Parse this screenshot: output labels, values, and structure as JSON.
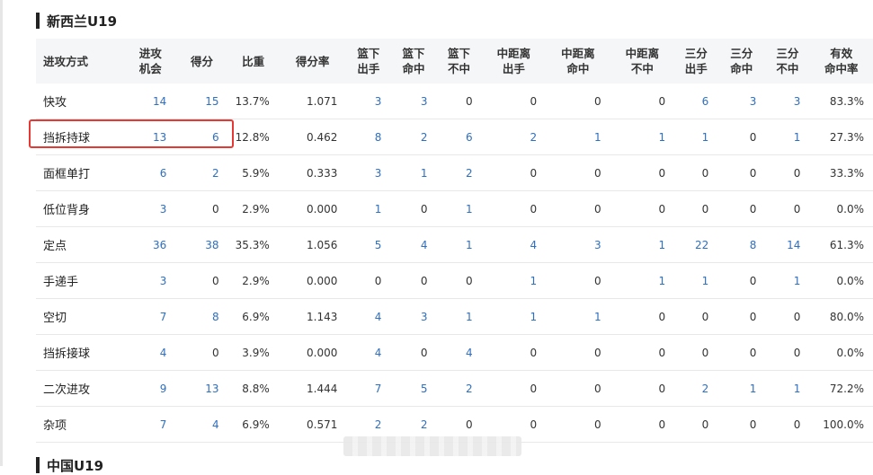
{
  "section_title": "新西兰U19",
  "next_section_title": "中国U19",
  "columns": [
    {
      "key": "type",
      "label": [
        "进攻方式"
      ]
    },
    {
      "key": "opp",
      "label": [
        "进攻",
        "机会"
      ]
    },
    {
      "key": "pts",
      "label": [
        "得分"
      ]
    },
    {
      "key": "pct",
      "label": [
        "比重"
      ]
    },
    {
      "key": "ppp",
      "label": [
        "得分率"
      ]
    },
    {
      "key": "ra",
      "label": [
        "篮下",
        "出手"
      ]
    },
    {
      "key": "rm",
      "label": [
        "篮下",
        "命中"
      ]
    },
    {
      "key": "rx",
      "label": [
        "篮下",
        "不中"
      ]
    },
    {
      "key": "ma",
      "label": [
        "中距离",
        "出手"
      ]
    },
    {
      "key": "mm",
      "label": [
        "中距离",
        "命中"
      ]
    },
    {
      "key": "mx",
      "label": [
        "中距离",
        "不中"
      ]
    },
    {
      "key": "ta",
      "label": [
        "三分",
        "出手"
      ]
    },
    {
      "key": "tm",
      "label": [
        "三分",
        "命中"
      ]
    },
    {
      "key": "tx",
      "label": [
        "三分",
        "不中"
      ]
    },
    {
      "key": "efg",
      "label": [
        "有效",
        "命中率"
      ]
    }
  ],
  "rows": [
    [
      "快攻",
      "14",
      "15",
      "13.7%",
      "1.071",
      "3",
      "3",
      "0",
      "0",
      "0",
      "0",
      "6",
      "3",
      "3",
      "83.3%"
    ],
    [
      "挡拆持球",
      "13",
      "6",
      "12.8%",
      "0.462",
      "8",
      "2",
      "6",
      "2",
      "1",
      "1",
      "1",
      "0",
      "1",
      "27.3%"
    ],
    [
      "面框单打",
      "6",
      "2",
      "5.9%",
      "0.333",
      "3",
      "1",
      "2",
      "0",
      "0",
      "0",
      "0",
      "0",
      "0",
      "33.3%"
    ],
    [
      "低位背身",
      "3",
      "0",
      "2.9%",
      "0.000",
      "1",
      "0",
      "1",
      "0",
      "0",
      "0",
      "0",
      "0",
      "0",
      "0.0%"
    ],
    [
      "定点",
      "36",
      "38",
      "35.3%",
      "1.056",
      "5",
      "4",
      "1",
      "4",
      "3",
      "1",
      "22",
      "8",
      "14",
      "61.3%"
    ],
    [
      "手递手",
      "3",
      "0",
      "2.9%",
      "0.000",
      "0",
      "0",
      "0",
      "1",
      "0",
      "1",
      "1",
      "0",
      "1",
      "0.0%"
    ],
    [
      "空切",
      "7",
      "8",
      "6.9%",
      "1.143",
      "4",
      "3",
      "1",
      "1",
      "1",
      "0",
      "0",
      "0",
      "0",
      "80.0%"
    ],
    [
      "挡拆接球",
      "4",
      "0",
      "3.9%",
      "0.000",
      "4",
      "0",
      "4",
      "0",
      "0",
      "0",
      "0",
      "0",
      "0",
      "0.0%"
    ],
    [
      "二次进攻",
      "9",
      "13",
      "8.8%",
      "1.444",
      "7",
      "5",
      "2",
      "0",
      "0",
      "0",
      "2",
      "1",
      "1",
      "72.2%"
    ],
    [
      "杂项",
      "7",
      "4",
      "6.9%",
      "0.571",
      "2",
      "2",
      "0",
      "0",
      "0",
      "0",
      "0",
      "0",
      "0",
      "100.0%"
    ]
  ],
  "highlighted_row": "挡拆持球",
  "colors": {
    "link": "#2f6fbf",
    "text": "#333333",
    "header_bg": "#f5f6f8",
    "highlight": "#e53935"
  }
}
